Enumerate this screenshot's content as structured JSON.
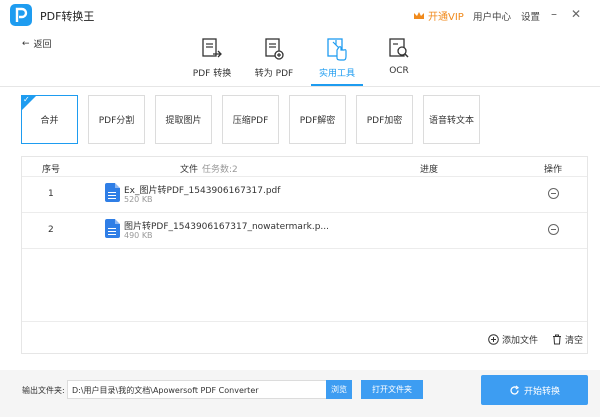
{
  "app": {
    "title": "PDF转换王",
    "vip_label": "开通VIP",
    "user_center": "用户中心",
    "settings": "设置",
    "accent": "#1e9cf0",
    "vip_color": "#f08a1c"
  },
  "back_label": "返回",
  "nav": {
    "tabs": [
      {
        "label": "PDF 转换",
        "icon": "pdf-convert-icon"
      },
      {
        "label": "转为 PDF",
        "icon": "to-pdf-icon"
      },
      {
        "label": "实用工具",
        "icon": "tools-icon",
        "active": true
      },
      {
        "label": "OCR",
        "icon": "ocr-icon"
      }
    ]
  },
  "tools": [
    {
      "label": "合并",
      "active": true
    },
    {
      "label": "PDF分割"
    },
    {
      "label": "提取图片"
    },
    {
      "label": "压缩PDF"
    },
    {
      "label": "PDF解密"
    },
    {
      "label": "PDF加密"
    },
    {
      "label": "语音转文本"
    }
  ],
  "table": {
    "headers": {
      "index": "序号",
      "file": "文件",
      "task_count": "任务数:2",
      "progress": "进度",
      "action": "操作"
    },
    "rows": [
      {
        "index": "1",
        "name": "Ex_图片转PDF_1543906167317.pdf",
        "size": "520 KB"
      },
      {
        "index": "2",
        "name": "图片转PDF_1543906167317_nowatermark.p...",
        "size": "490 KB"
      }
    ],
    "add_file": "添加文件",
    "clear": "清空"
  },
  "bottom": {
    "output_label": "输出文件夹:",
    "output_path": "D:\\用户目录\\我的文档\\Apowersoft PDF Converter",
    "browse": "浏览",
    "open_folder": "打开文件夹",
    "start": "开始转换"
  }
}
